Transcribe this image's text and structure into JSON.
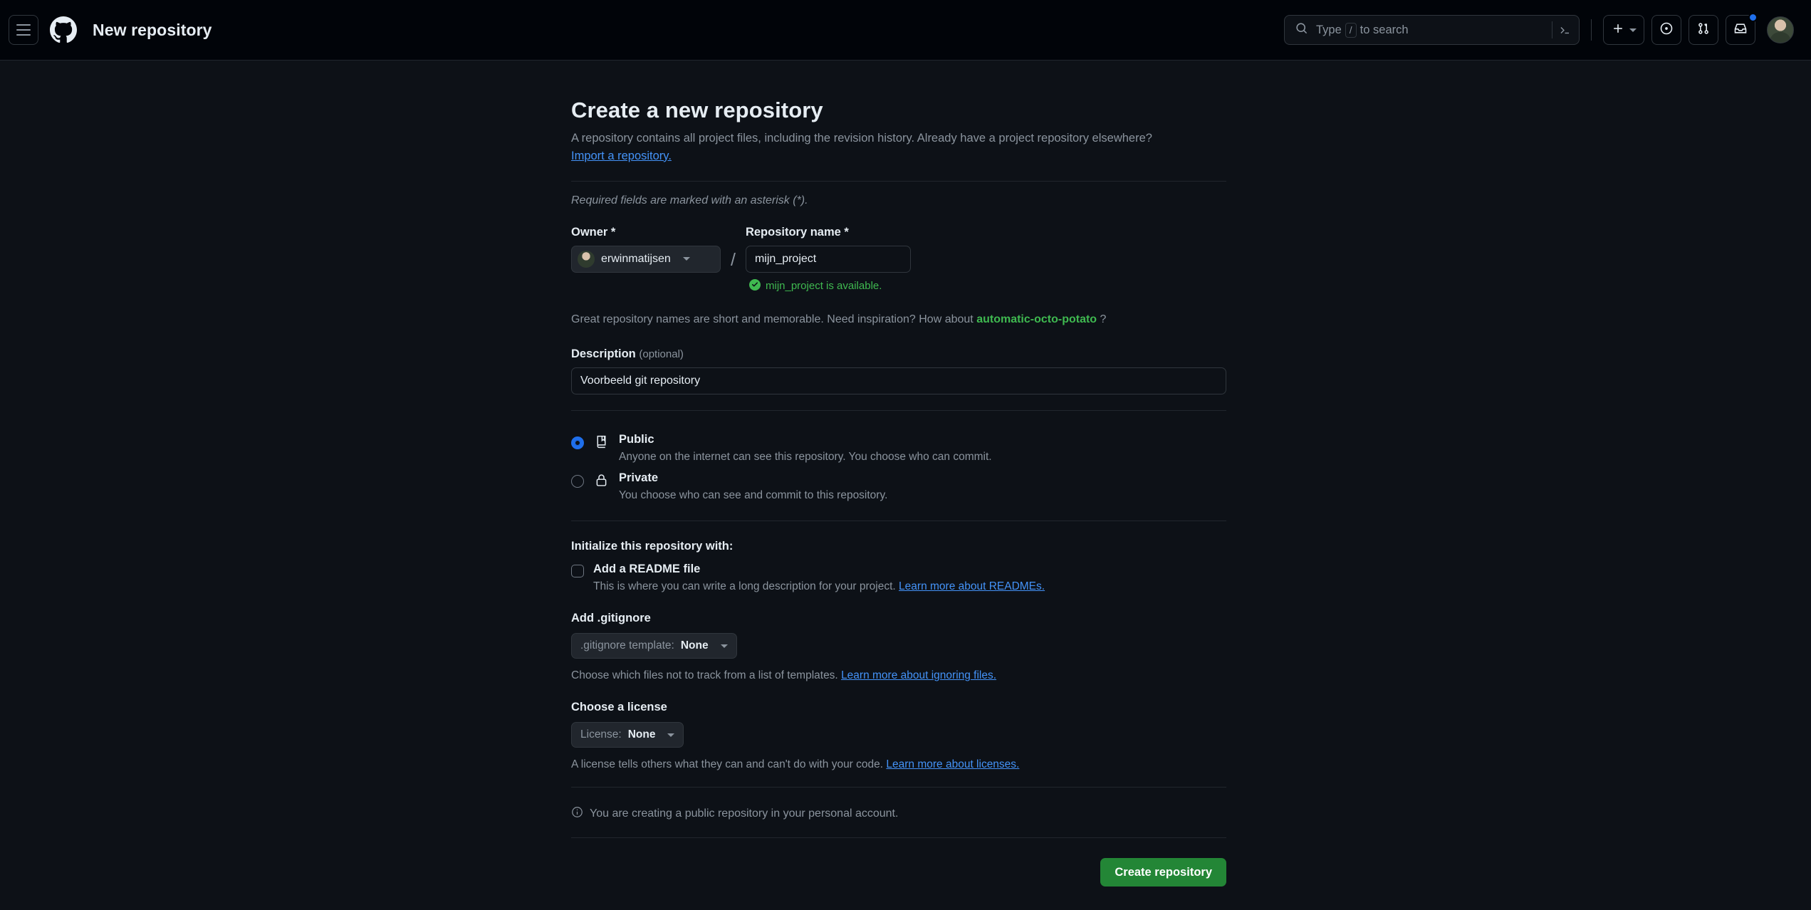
{
  "header": {
    "menu_icon": "hamburger-icon",
    "logo_icon": "github-logo-icon",
    "title": "New repository",
    "search": {
      "icon": "search-icon",
      "prefix": "Type",
      "key": "/",
      "suffix": "to search",
      "command_palette_icon": "terminal-icon"
    },
    "actions": {
      "create_new_icon": "plus-icon",
      "create_new_caret": "chevron-down-icon",
      "issues_icon": "issue-opened-icon",
      "pull_requests_icon": "git-pull-request-icon",
      "notifications_icon": "inbox-icon",
      "notifications_has_unread": true,
      "avatar": "user-avatar"
    }
  },
  "main": {
    "title": "Create a new repository",
    "description": "A repository contains all project files, including the revision history. Already have a project repository elsewhere?",
    "import_link": "Import a repository.",
    "required_note": "Required fields are marked with an asterisk (*).",
    "owner": {
      "label": "Owner *",
      "value": "erwinmatijsen",
      "caret_icon": "chevron-down-icon",
      "avatar": "owner-avatar"
    },
    "separator": "/",
    "repo_name": {
      "label": "Repository name *",
      "value": "mijn_project",
      "availability": {
        "icon": "check-circle-icon",
        "text": "mijn_project is available."
      }
    },
    "inspiration": {
      "prefix": "Great repository names are short and memorable. Need inspiration? How about",
      "suggestion": "automatic-octo-potato",
      "suffix": "?"
    },
    "description_field": {
      "label": "Description",
      "optional": "(optional)",
      "value": "Voorbeeld git repository",
      "placeholder": ""
    },
    "visibility": [
      {
        "id": "public",
        "icon": "repo-icon",
        "title": "Public",
        "subtitle": "Anyone on the internet can see this repository. You choose who can commit.",
        "selected": true
      },
      {
        "id": "private",
        "icon": "lock-icon",
        "title": "Private",
        "subtitle": "You choose who can see and commit to this repository.",
        "selected": false
      }
    ],
    "initialize": {
      "heading": "Initialize this repository with:",
      "readme": {
        "checked": false,
        "title": "Add a README file",
        "subtitle": "This is where you can write a long description for your project.",
        "link": "Learn more about READMEs."
      }
    },
    "gitignore": {
      "heading": "Add .gitignore",
      "button_prefix": ".gitignore template:",
      "button_value": "None",
      "caret_icon": "chevron-down-icon",
      "help_prefix": "Choose which files not to track from a list of templates.",
      "help_link": "Learn more about ignoring files."
    },
    "license": {
      "heading": "Choose a license",
      "button_prefix": "License:",
      "button_value": "None",
      "caret_icon": "chevron-down-icon",
      "help_prefix": "A license tells others what they can and can't do with your code.",
      "help_link": "Learn more about licenses."
    },
    "info_note": {
      "icon": "info-icon",
      "text": "You are creating a public repository in your personal account."
    },
    "submit_label": "Create repository"
  },
  "colors": {
    "background": "#0d1117",
    "header_bg": "#010409",
    "border": "#30363d",
    "text": "#e6edf3",
    "muted": "#8b949e",
    "link": "#4493f8",
    "success": "#3fb950",
    "accent_blue": "#1f6feb",
    "button_green": "#238636"
  }
}
